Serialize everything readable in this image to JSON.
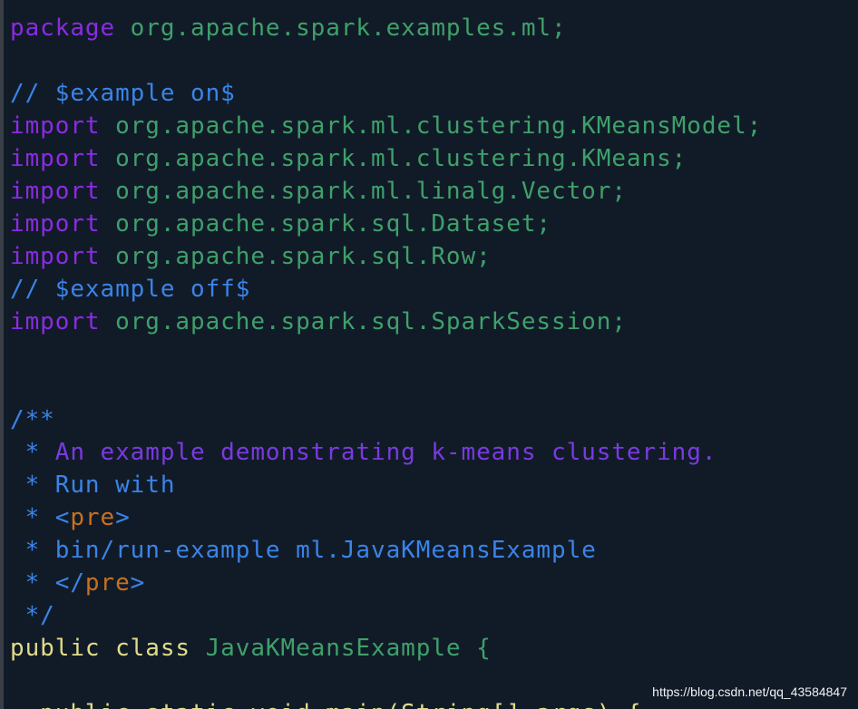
{
  "code": {
    "lines": [
      [
        {
          "t": "package",
          "c": "kw-purple"
        },
        {
          "t": " org.apache.spark.examples.ml;",
          "c": "green"
        }
      ],
      [],
      [
        {
          "t": "// $example on$",
          "c": "blue"
        }
      ],
      [
        {
          "t": "import",
          "c": "kw-purple"
        },
        {
          "t": " org.apache.spark.ml.clustering.KMeansModel;",
          "c": "green"
        }
      ],
      [
        {
          "t": "import",
          "c": "kw-purple"
        },
        {
          "t": " org.apache.spark.ml.clustering.KMeans;",
          "c": "green"
        }
      ],
      [
        {
          "t": "import",
          "c": "kw-purple"
        },
        {
          "t": " org.apache.spark.ml.linalg.Vector;",
          "c": "green"
        }
      ],
      [
        {
          "t": "import",
          "c": "kw-purple"
        },
        {
          "t": " org.apache.spark.sql.Dataset;",
          "c": "green"
        }
      ],
      [
        {
          "t": "import",
          "c": "kw-purple"
        },
        {
          "t": " org.apache.spark.sql.Row;",
          "c": "green"
        }
      ],
      [
        {
          "t": "// $example off$",
          "c": "blue"
        }
      ],
      [
        {
          "t": "import",
          "c": "kw-purple"
        },
        {
          "t": " org.apache.spark.sql.SparkSession;",
          "c": "green"
        }
      ],
      [],
      [],
      [
        {
          "t": "/**",
          "c": "blue"
        }
      ],
      [
        {
          "t": " * ",
          "c": "blue"
        },
        {
          "t": "An example demonstrating k-means clustering.",
          "c": "violet"
        }
      ],
      [
        {
          "t": " * Run with",
          "c": "blue"
        }
      ],
      [
        {
          "t": " * <",
          "c": "blue"
        },
        {
          "t": "pre",
          "c": "orange"
        },
        {
          "t": ">",
          "c": "blue"
        }
      ],
      [
        {
          "t": " * bin/run-example ml.JavaKMeansExample",
          "c": "blue"
        }
      ],
      [
        {
          "t": " * </",
          "c": "blue"
        },
        {
          "t": "pre",
          "c": "orange"
        },
        {
          "t": ">",
          "c": "blue"
        }
      ],
      [
        {
          "t": " */",
          "c": "blue"
        }
      ],
      [
        {
          "t": "public",
          "c": "kw-yellow"
        },
        {
          "t": " ",
          "c": "green"
        },
        {
          "t": "class",
          "c": "kw-yellow"
        },
        {
          "t": " JavaKMeansExample {",
          "c": "green"
        }
      ],
      [],
      [
        {
          "t": "  public static void main(String[] args) {",
          "c": "kw-yellow"
        }
      ]
    ]
  },
  "watermark": {
    "text": "https://blog.csdn.net/qq_43584847"
  }
}
